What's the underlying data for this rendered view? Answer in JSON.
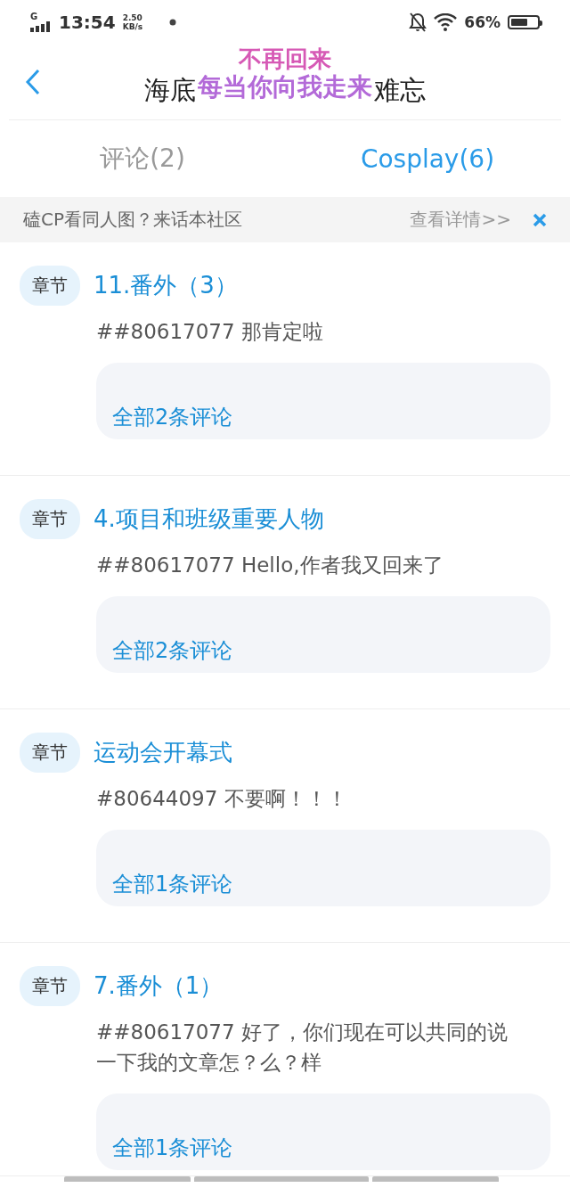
{
  "status_bar": {
    "network": "G",
    "time": "13:54",
    "speed_value": "2.50",
    "speed_unit": "KB/s",
    "battery": "66%"
  },
  "header": {
    "title_start": "海底",
    "title_end": "难忘",
    "overlay_lines": [
      "不再回来",
      "每当你向我走来"
    ]
  },
  "tabs": [
    {
      "label": "评论(2)",
      "selected": false
    },
    {
      "label": "Cosplay(6)",
      "selected": true
    }
  ],
  "banner": {
    "text": "磕CP看同人图？来话本社区",
    "link": "查看详情>>"
  },
  "comments": [
    {
      "tag": "章节",
      "chapter": "11.番外（3）",
      "text": "##80617077 那肯定啦",
      "replies": "全部2条评论"
    },
    {
      "tag": "章节",
      "chapter": "4.项目和班级重要人物",
      "text": "##80617077 Hello,作者我又回来了",
      "replies": "全部2条评论"
    },
    {
      "tag": "章节",
      "chapter": "运动会开幕式",
      "text": "#80644097 不要啊！！！",
      "replies": "全部1条评论"
    },
    {
      "tag": "章节",
      "chapter": "7.番外（1）",
      "text": "##80617077 好了，你们现在可以共同的说一下我的文章怎？么？样",
      "replies": "全部1条评论"
    }
  ]
}
